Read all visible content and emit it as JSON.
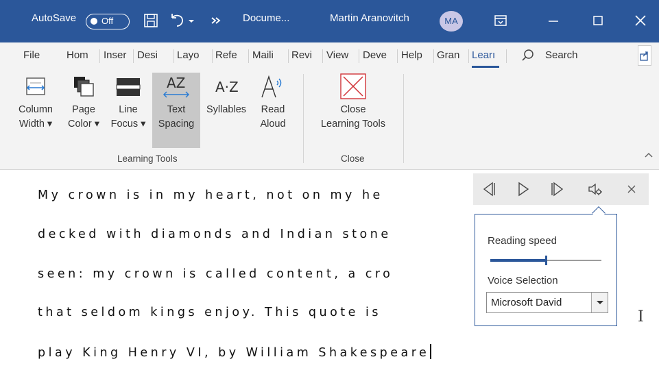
{
  "titlebar": {
    "autosave_label": "AutoSave",
    "autosave_state": "Off",
    "doc_title": "Docume...",
    "user_name": "Martin Aranovitch",
    "user_initials": "MA"
  },
  "tabs": [
    {
      "label": "File"
    },
    {
      "label": "Hom"
    },
    {
      "label": "Inser"
    },
    {
      "label": "Desi"
    },
    {
      "label": "Layo"
    },
    {
      "label": "Refe"
    },
    {
      "label": "Maili"
    },
    {
      "label": "Revi"
    },
    {
      "label": "View"
    },
    {
      "label": "Deve"
    },
    {
      "label": "Help"
    },
    {
      "label": "Gran"
    },
    {
      "label": "Learı"
    }
  ],
  "search_label": "Search",
  "ribbon": {
    "column_width": {
      "line1": "Column",
      "line2": "Width ▾"
    },
    "page_color": {
      "line1": "Page",
      "line2": "Color ▾"
    },
    "line_focus": {
      "line1": "Line",
      "line2": "Focus ▾"
    },
    "text_spacing": {
      "line1": "Text",
      "line2": "Spacing"
    },
    "syllables": {
      "line1": "Syllables",
      "line2": ""
    },
    "read_aloud": {
      "line1": "Read",
      "line2": "Aloud"
    },
    "close_learning": {
      "line1": "Close",
      "line2": "Learning Tools"
    },
    "group_learning": "Learning Tools",
    "group_close": "Close"
  },
  "document": {
    "lines": [
      "My crown is in my heart, not on my he",
      "decked with diamonds and Indian stone",
      "seen: my crown is called content, a cro",
      "that seldom kings enjoy. This quote is",
      "play King Henry VI, by William Shakespeare"
    ]
  },
  "read_aloud": {
    "reading_speed_label": "Reading speed",
    "reading_speed_fraction": 0.5,
    "voice_label": "Voice Selection",
    "voice_value": "Microsoft David"
  },
  "colors": {
    "brand": "#2b579a",
    "ribbon_bg": "#f3f3f3"
  }
}
